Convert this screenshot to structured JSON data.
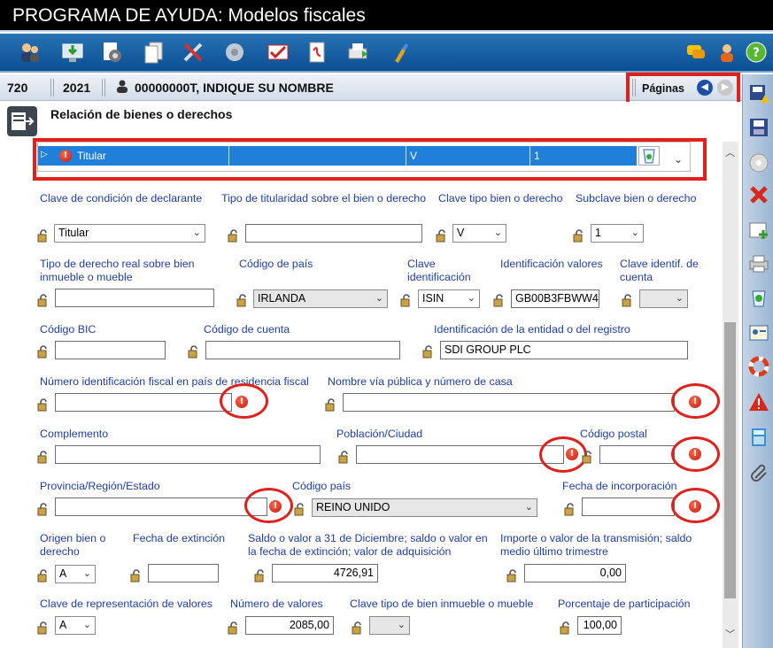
{
  "window": {
    "title": "PROGRAMA DE AYUDA: Modelos fiscales"
  },
  "infobar": {
    "model": "720",
    "year": "2021",
    "user": "00000000T, INDIQUE SU NOMBRE",
    "pages_label": "Páginas"
  },
  "section": {
    "title": "Relación de bienes o derechos"
  },
  "grid_row": {
    "col1": "Titular",
    "col2": "",
    "col3": "V",
    "col4": "1"
  },
  "fields": {
    "clave_condicion": {
      "label": "Clave de condición de declarante",
      "value": "Titular"
    },
    "tipo_titularidad": {
      "label": "Tipo de titularidad sobre el bien o derecho",
      "value": ""
    },
    "clave_tipo_bien": {
      "label": "Clave tipo bien o derecho",
      "value": "V"
    },
    "subclave": {
      "label": "Subclave bien o derecho",
      "value": "1"
    },
    "tipo_derecho": {
      "label": "Tipo de derecho real sobre bien inmueble o mueble",
      "value": ""
    },
    "codigo_pais": {
      "label": "Código de país",
      "value": "IRLANDA"
    },
    "clave_identificacion": {
      "label": "Clave identificación",
      "value": "ISIN"
    },
    "identificacion_valores": {
      "label": "Identificación valores",
      "value": "GB00B3FBWW43"
    },
    "clave_identif_cuenta": {
      "label": "Clave identif. de cuenta",
      "value": ""
    },
    "codigo_bic": {
      "label": "Código BIC",
      "value": ""
    },
    "codigo_cuenta": {
      "label": "Código de cuenta",
      "value": ""
    },
    "identificacion_entidad": {
      "label": "Identificación de la entidad o del registro",
      "value": "SDI GROUP PLC"
    },
    "nif_residencia": {
      "label": "Número identificación fiscal en país de residencia fiscal",
      "value": ""
    },
    "nombre_via": {
      "label": "Nombre vía pública y número de casa",
      "value": ""
    },
    "complemento": {
      "label": "Complemento",
      "value": ""
    },
    "poblacion": {
      "label": "Población/Ciudad",
      "value": ""
    },
    "codigo_postal": {
      "label": "Código postal",
      "value": ""
    },
    "provincia": {
      "label": "Provincia/Región/Estado",
      "value": ""
    },
    "codigo_pais2": {
      "label": "Código país",
      "value": "REINO UNIDO"
    },
    "fecha_incorporacion": {
      "label": "Fecha de incorporación",
      "value": ""
    },
    "origen_bien": {
      "label": "Origen bien o derecho",
      "value": "A"
    },
    "fecha_extincion": {
      "label": "Fecha de extinción",
      "value": ""
    },
    "saldo_valor": {
      "label": "Saldo o valor a 31 de Diciembre; saldo o valor en la fecha de extinción; valor de adquisición",
      "value": "4726,91"
    },
    "importe_transmision": {
      "label": "Importe o valor de la transmisión; saldo medio último trimestre",
      "value": "0,00"
    },
    "clave_representacion": {
      "label": "Clave de representación de valores",
      "value": "A"
    },
    "numero_valores": {
      "label": "Número de valores",
      "value": "2085,00"
    },
    "clave_tipo_inmueble": {
      "label": "Clave tipo de bien inmueble o mueble",
      "value": ""
    },
    "porcentaje": {
      "label": "Porcentaje de participación",
      "value": "100,00"
    }
  },
  "colors": {
    "label_blue": "#1f3ea6",
    "toolbar_blue": "#0b4f93",
    "highlight_red": "#e0201b",
    "selected_row": "#1f7fd9"
  }
}
